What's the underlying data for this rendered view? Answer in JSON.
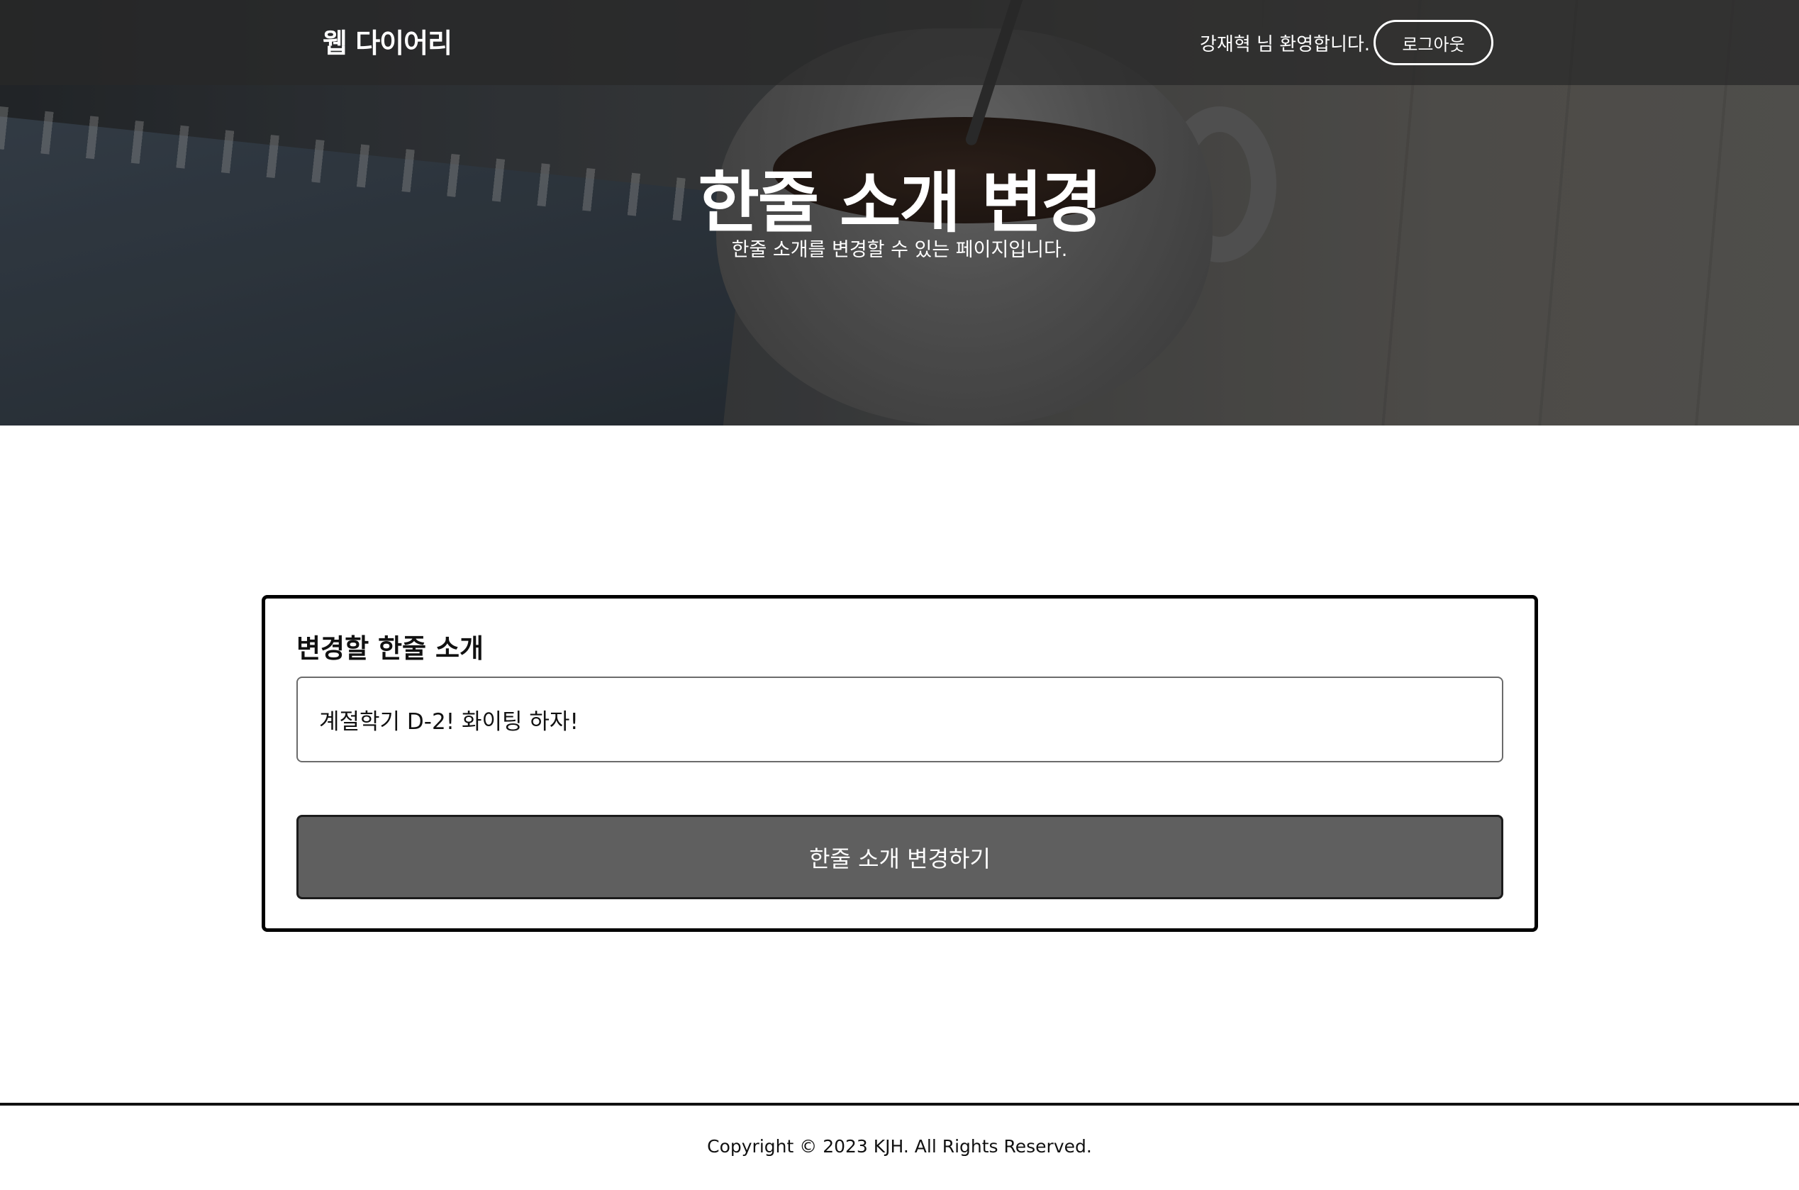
{
  "header": {
    "brand": "웹 다이어리",
    "welcome": "강재혁 님 환영합니다.",
    "logout_label": "로그아웃"
  },
  "hero": {
    "title": "한줄 소개 변경",
    "subtitle": "한줄 소개를 변경할 수 있는 페이지입니다."
  },
  "form": {
    "label": "변경할 한줄 소개",
    "intro_value": "계절학기 D-2! 화이팅 하자!",
    "submit_label": "한줄 소개 변경하기"
  },
  "footer": {
    "copyright": "Copyright © 2023 KJH. All Rights Reserved."
  }
}
